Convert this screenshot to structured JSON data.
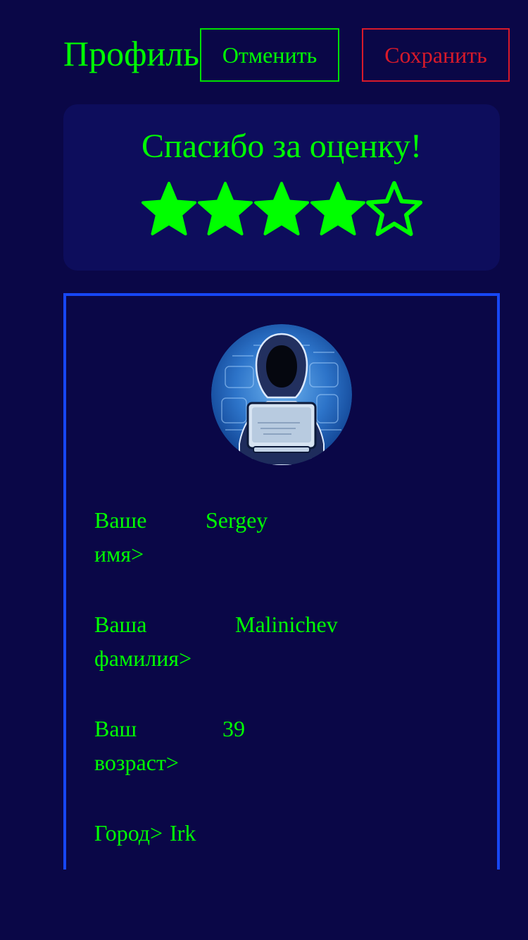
{
  "header": {
    "title": "Профиль",
    "cancel_label": "Отменить",
    "save_label": "Сохранить"
  },
  "rating": {
    "thanks_text": "Спасибо за оценку!",
    "value": 4,
    "max": 5
  },
  "profile": {
    "avatar_icon": "hacker-avatar-icon",
    "fields": [
      {
        "label_line1": "Ваше",
        "label_line2": "имя>",
        "value": "Sergey"
      },
      {
        "label_line1": "Ваша",
        "label_line2": "фамилия>",
        "value": "Malinichev"
      },
      {
        "label_line1": "Ваш",
        "label_line2": "возраст>",
        "value": "39"
      },
      {
        "label_line1": "Город>",
        "label_line2": "",
        "value": "Irk"
      }
    ]
  },
  "colors": {
    "background": "#0a0747",
    "accent_green": "#00ff00",
    "cancel_border": "#00e000",
    "save_red": "#d81a2a",
    "card_bg": "#0d0d5c",
    "profile_border": "#1747f5"
  }
}
